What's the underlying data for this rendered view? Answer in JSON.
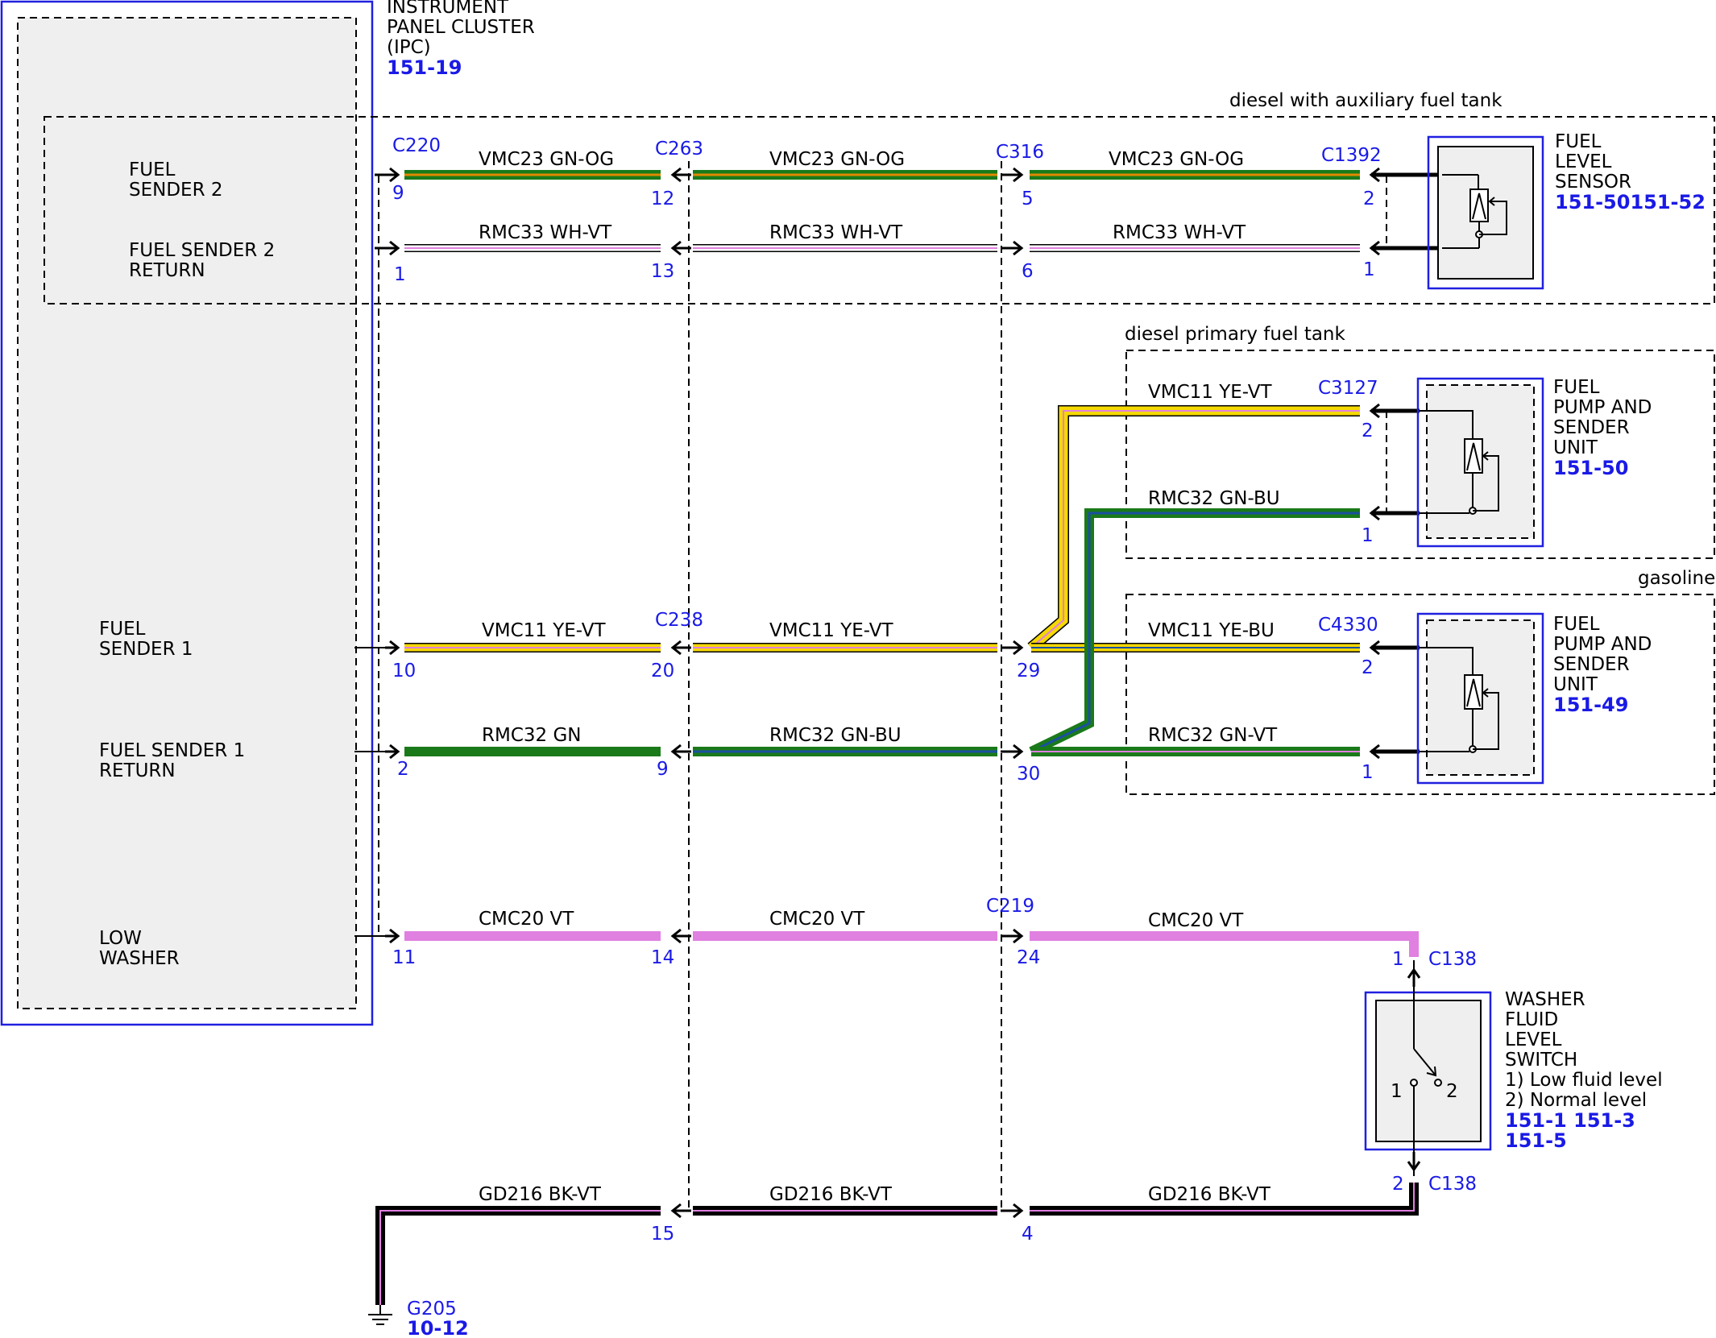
{
  "ipc": {
    "title_l1": "INSTRUMENT",
    "title_l2": "PANEL CLUSTER",
    "title_l3": "(IPC)",
    "ref": "151-19"
  },
  "regions": {
    "aux": "diesel with auxiliary fuel tank",
    "primary": "diesel primary fuel tank",
    "gas": "gasoline"
  },
  "pins": {
    "fs2_l1": "FUEL",
    "fs2_l2": "SENDER 2",
    "fs2r_l1": "FUEL SENDER 2",
    "fs2r_l2": "RETURN",
    "fs1_l1": "FUEL",
    "fs1_l2": "SENDER 1",
    "fs1r_l1": "FUEL SENDER 1",
    "fs1r_l2": "RETURN",
    "lw_l1": "LOW",
    "lw_l2": "WASHER"
  },
  "connectors": {
    "c220": "C220",
    "c263": "C263",
    "c316": "C316",
    "c1392": "C1392",
    "c3127": "C3127",
    "c238": "C238",
    "c4330": "C4330",
    "c219": "C219",
    "c138a": "C138",
    "c138b": "C138",
    "g205": "G205"
  },
  "pin_numbers": {
    "p9": "9",
    "p1": "1",
    "p10": "10",
    "p2": "2",
    "p11": "11",
    "p12": "12",
    "p13": "13",
    "p20": "20",
    "p9b": "9",
    "p14": "14",
    "p15": "15",
    "p5": "5",
    "p6": "6",
    "p29": "29",
    "p30": "30",
    "p24": "24",
    "p4": "4",
    "p2a": "2",
    "p1a": "1",
    "p2b": "2",
    "p1b": "1",
    "p2c": "2",
    "p1c": "1",
    "c138_1": "1",
    "c138_2": "2",
    "sw1": "1",
    "sw2": "2"
  },
  "wires": {
    "w1a": "VMC23  GN-OG",
    "w1b": "VMC23  GN-OG",
    "w1c": "VMC23  GN-OG",
    "w2a": "RMC33  WH-VT",
    "w2b": "RMC33  WH-VT",
    "w2c": "RMC33  WH-VT",
    "w3a": "VMC11  YE-VT",
    "w3b": "VMC11 YE-VT",
    "w3p": "VMC11 YE-VT",
    "w3g": "VMC11 YE-BU",
    "w4a": "RMC32  GN",
    "w4b": "RMC32 GN-BU",
    "w4p": "RMC32 GN-BU",
    "w4g": "RMC32 GN-VT",
    "w5a": "CMC20   VT",
    "w5b": "CMC20   VT",
    "w5c": "CMC20   VT",
    "w6a": "GD216  BK-VT",
    "w6b": "GD216  BK-VT",
    "w6c": "GD216  BK-VT"
  },
  "components": {
    "fls_l1": "FUEL",
    "fls_l2": "LEVEL",
    "fls_l3": "SENSOR",
    "fls_ref": "151-50151-52",
    "fp1_l1": "FUEL",
    "fp1_l2": "PUMP AND",
    "fp1_l3": "SENDER",
    "fp1_l4": "UNIT",
    "fp1_ref": "151-50",
    "fp2_l1": "FUEL",
    "fp2_l2": "PUMP AND",
    "fp2_l3": "SENDER",
    "fp2_l4": "UNIT",
    "fp2_ref": "151-49",
    "ws_l1": "WASHER",
    "ws_l2": "FLUID",
    "ws_l3": "LEVEL",
    "ws_l4": "SWITCH",
    "ws_n1": "1) Low fluid level",
    "ws_n2": "2) Normal level",
    "ws_ref1": "151-1 151-3",
    "ws_ref2": "151-5"
  },
  "ground_ref": "10-12",
  "colors": {
    "green": "#1a7a1a",
    "orange": "#e08a00",
    "yellow": "#f5d800",
    "violet": "#e080e0",
    "blue": "#1a50a0",
    "white": "#ffffff",
    "black": "#000000",
    "ref_blue": "#1a1ae6"
  }
}
